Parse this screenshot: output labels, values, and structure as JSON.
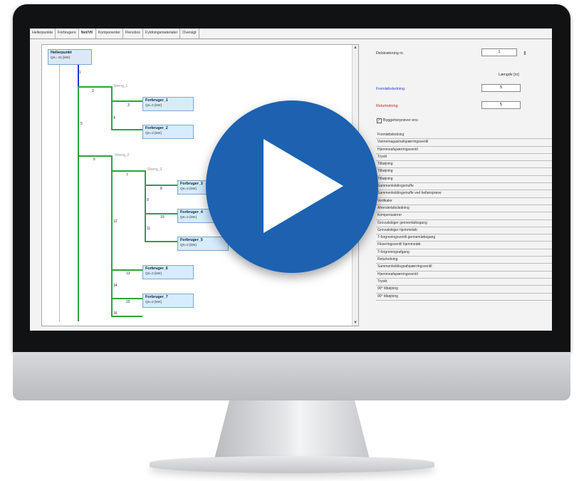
{
  "tabs": [
    "Hellerpunkte",
    "Forbrugere",
    "Net/VK",
    "Komponenter",
    "Flensbos",
    "Fyldningsmaterialer",
    "Oversigt"
  ],
  "active_tab_index": 2,
  "tree": {
    "root": {
      "name": "Hellerpunkt",
      "sub": "Qn= 31 [kW]"
    },
    "strands": [
      "Streng_1",
      "Streng_2",
      "Streng_3"
    ],
    "nodes": [
      {
        "name": "Forbruger_1",
        "sub": "Qn=2 [kW]"
      },
      {
        "name": "Forbruger_2",
        "sub": "Qn=2 [kW]"
      },
      {
        "name": "Forbruger_3",
        "sub": "Qn=2 [kW]"
      },
      {
        "name": "Forbruger_4",
        "sub": "Qn=2 [kW]"
      },
      {
        "name": "Forbruger_5",
        "sub": "Qn=2 [kW]"
      },
      {
        "name": "Forbruger_6",
        "sub": "Qn=2 [kW]"
      },
      {
        "name": "Forbruger_7",
        "sub": "Qn=2 [kW]"
      }
    ],
    "segment_labels": [
      "1",
      "2",
      "3",
      "4",
      "5",
      "6",
      "7",
      "8",
      "9",
      "10",
      "11",
      "12",
      "13",
      "14",
      "15",
      "16"
    ]
  },
  "right": {
    "section_label": "Delstrækning nr.",
    "section_value": "1",
    "length_header": "Længde [m]",
    "supply_label": "Fremløbsledning",
    "supply_value": "5",
    "return_label": "Returledning",
    "return_value": "5",
    "checkbox_label": "Byggeherprøver ens",
    "checkbox_checked": true,
    "table_rows": [
      "Fremløbsledning",
      "Varmemagasinafspærringsventil",
      "Hjemmeafspærringsventil",
      "Tryskt",
      "Tilbøjning",
      "Tilbøjning",
      "Tilbøjning",
      "Sammenkoblingsmuffe",
      "Sammenkoblingsmuffe ved heltørsprøve",
      "Vertikaler",
      "Afrenderløbsledning",
      "Kompensatorer",
      "Grovudskiger gennemløbsgang",
      "Grovudskiger hjemmeløb",
      "T-forgreningsventil gennemløbsgang",
      "Fikseringsventil hjemmeløb",
      "T-forgreningsafgang",
      "Returledning",
      "Sammenkoblingsafspærringsventil",
      "Hjemmeafspærringsventil",
      "Tryskt",
      "90° tilbøjning",
      "90° tilbøjning"
    ]
  },
  "overlay": {
    "icon": "play-icon",
    "color": "#1c62b0"
  }
}
